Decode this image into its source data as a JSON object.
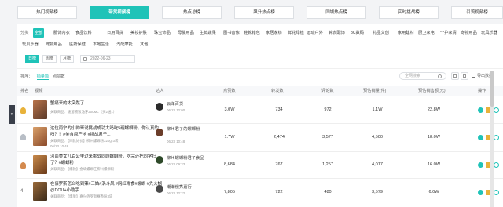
{
  "sidebar_handle": "«",
  "tabs": [
    "热门视频榜",
    "带货视频榜",
    "热点总榜",
    "飙升热点榜",
    "同城热点榜",
    "实时挑战榜",
    "引流视频榜"
  ],
  "category_label": "分类",
  "categories_row1": [
    "全部",
    "服饰内衣",
    "食品饮料",
    "日用百货",
    "美妆护肤",
    "珠宝饰品",
    "母婴用品",
    "生鲜蔬果",
    "图书音像",
    "鞋靴箱包",
    "家居家纺",
    "鲜花绿植",
    "运动户外",
    "钟表配饰",
    "3C数码",
    "礼品文创",
    "家用建材",
    "厨卫家电",
    "个护家清",
    "宠物用品",
    "玩具乐器"
  ],
  "categories_row2": [
    "玩具乐器",
    "宠物用品",
    "医药保健",
    "本地生活",
    "汽配摩托",
    "其他"
  ],
  "date_filter": {
    "day": "日榜",
    "week": "周榜",
    "month": "月榜",
    "date": "2022-06-23"
  },
  "sort": {
    "label": "排序：",
    "options": [
      "销量额",
      "点赞数"
    ]
  },
  "search_placeholder": "全网搜索",
  "export_label": "导出数据",
  "table": {
    "headers": [
      "排名",
      "视频",
      "达人",
      "点赞数",
      "转发数",
      "评论数",
      "预估销量(件)",
      "预估销售额(元)",
      "操作"
    ],
    "rows": [
      {
        "rank": "1",
        "title": "蟹痛来的太突然了",
        "goods": "关联商品：速溶液饭油牙200ML（买2送1）",
        "time": "",
        "creator": "云洋百货",
        "creator_date": "06/23 12:00",
        "likes": "3.0W",
        "shares": "734",
        "comments": "972",
        "sales": "1.1W",
        "gmv": "22.8W"
      },
      {
        "rank": "2",
        "title": "这位南宁的小帅哥说挑战成功大吗吃5碗螺蛳粉，你认真的吗？！#美食原产地 #挑战君子...",
        "goods": "关联商品：【同款好价】柳州螺蛳粉320g*3袋",
        "time": "06/23 10:48",
        "creator": "柳州君子的螺蛳粉",
        "creator_date": "06/23 10:48",
        "likes": "1.7W",
        "shares": "2,474",
        "comments": "3,577",
        "sales": "4,500",
        "gmv": "18.0W"
      },
      {
        "rank": "3",
        "title": "河南美女几百公里过来挑战同顾螺蛳粉，吃完还把同学扫了？#螺蛳粉",
        "goods": "关联商品：【爆款】金华螺蛳王柳州螺蛳粉",
        "time": "",
        "creator": "柳州螺蛳粉君子食品",
        "creator_date": "06/23 09:33",
        "likes": "8,684",
        "shares": "767",
        "comments": "1,257",
        "sales": "4,017",
        "gmv": "16.0W"
      },
      {
        "rank": "4",
        "title": "在佰罗斯怎么吃到辣#三姑#涡斗风 #网红零食#螺蛳 #先火锅 @DOU+小助手",
        "goods": "关联商品：【爆单】嘉兴佰罗斯赛香粉3袋",
        "time": "",
        "creator": "潮潮俄秀嘉行",
        "creator_date": "06/23 12:22",
        "likes": "7,805",
        "shares": "722",
        "comments": "480",
        "sales": "3,579",
        "gmv": "6.0W"
      }
    ]
  }
}
